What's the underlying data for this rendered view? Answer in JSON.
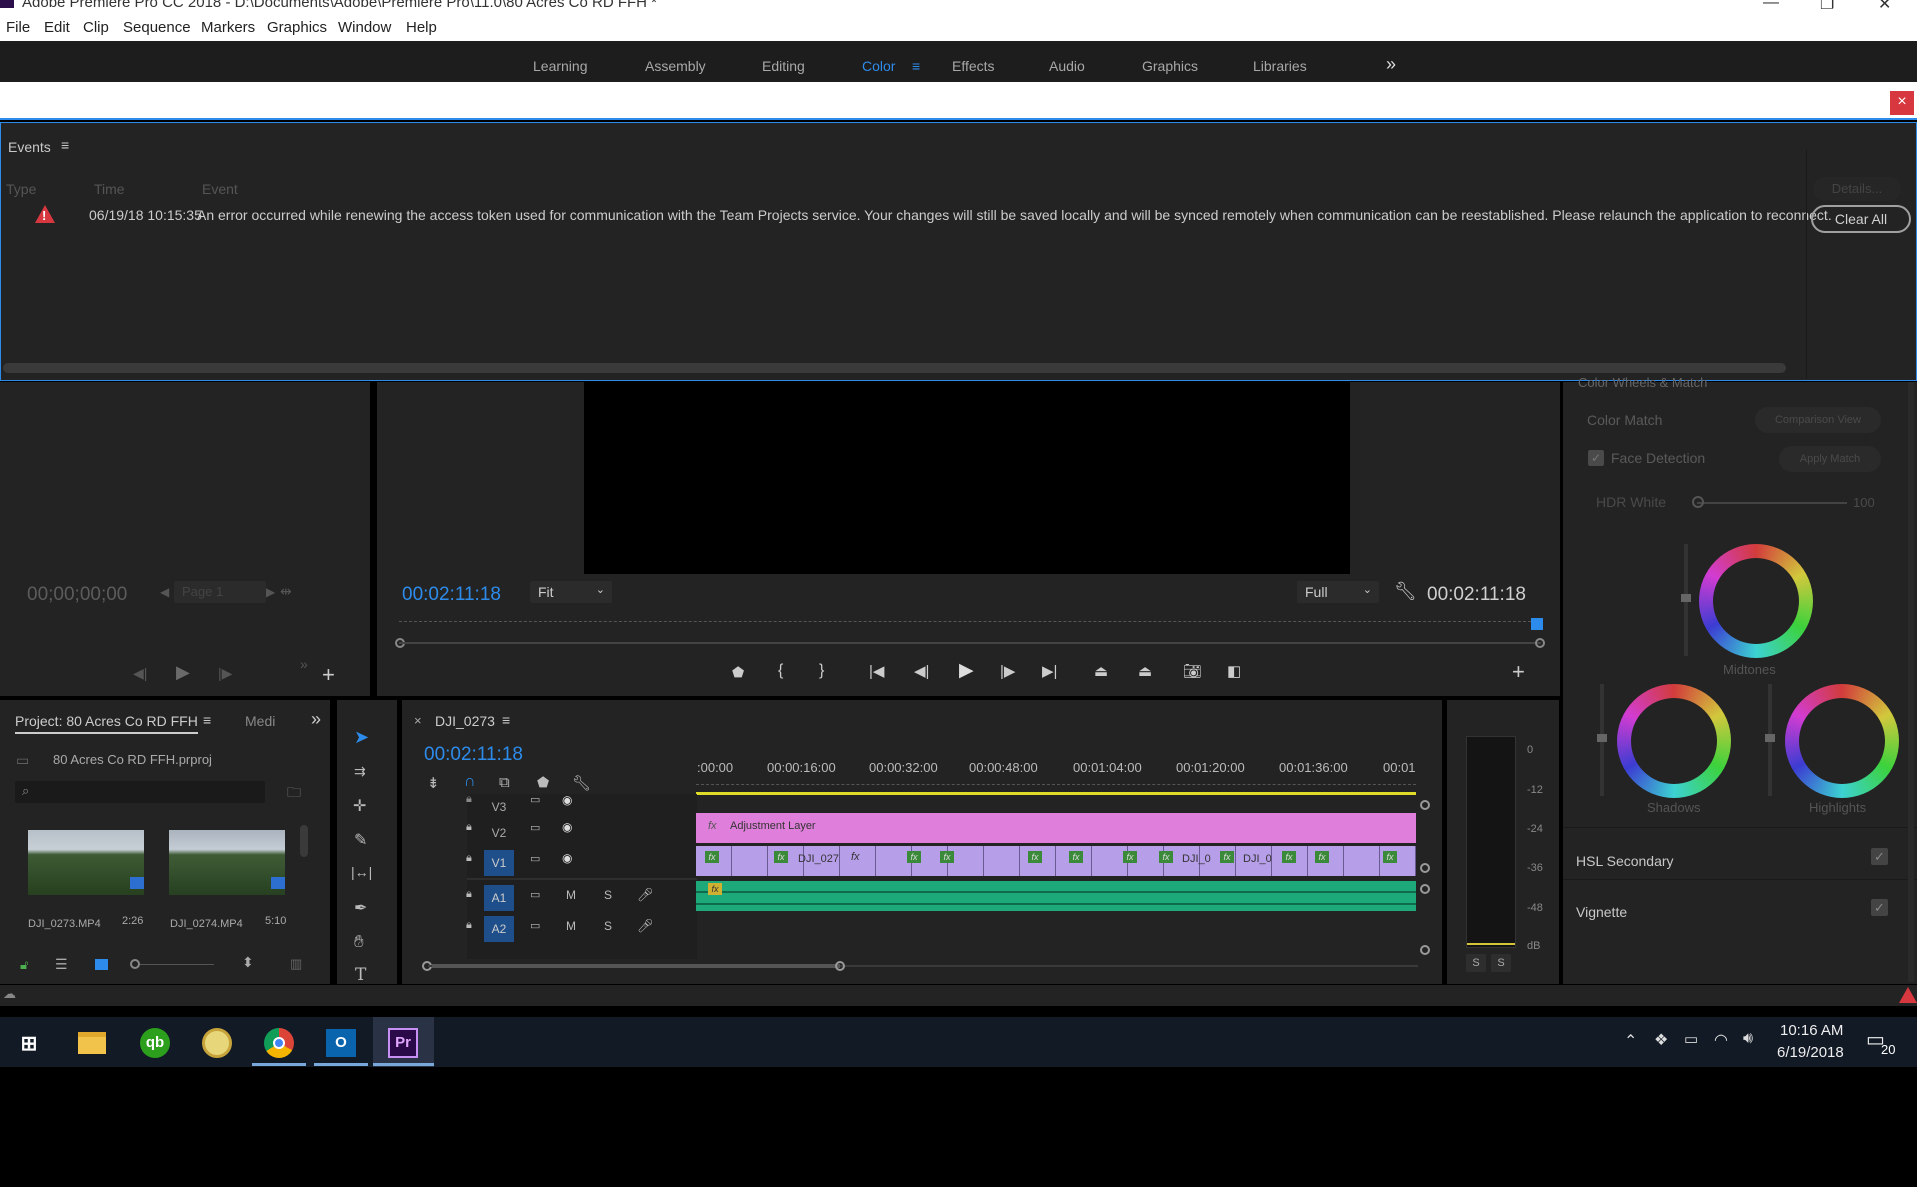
{
  "window": {
    "title": "Adobe Premiere Pro CC 2018 - D:\\Documents\\Adobe\\Premiere Pro\\11.0\\80 Acres Co RD FFH *"
  },
  "menu": [
    "File",
    "Edit",
    "Clip",
    "Sequence",
    "Markers",
    "Graphics",
    "Window",
    "Help"
  ],
  "workspaces": {
    "items": [
      "Learning",
      "Assembly",
      "Editing",
      "Color",
      "Effects",
      "Audio",
      "Graphics",
      "Libraries"
    ],
    "active": "Color",
    "more": "»"
  },
  "banner": {
    "close": "×"
  },
  "events": {
    "title": "Events",
    "menu_icon": "≡",
    "columns": [
      "Type",
      "Time",
      "Event"
    ],
    "rows": [
      {
        "type": "warning",
        "time": "06/19/18 10:15:35",
        "event": "An error occurred while renewing the access token used for communication with the Team Projects service. Your changes will still be saved locally and will be synced remotely when communication can be reestablished. Please relaunch the application to reconnect."
      }
    ],
    "details_label": "Details...",
    "clear_all_label": "Clear All"
  },
  "source_monitor": {
    "timecode": "00;00;00;00",
    "page_label": "Page 1"
  },
  "program_monitor": {
    "timecode_left": "00:02:11:18",
    "timecode_right": "00:02:11:18",
    "zoom": "Fit",
    "resolution": "Full"
  },
  "project": {
    "title": "Project: 80 Acres Co RD FFH",
    "menu_icon": "≡",
    "tab2": "Medi",
    "more": "»",
    "filename": "80 Acres Co RD FFH.prproj",
    "items": [
      {
        "name": "DJI_0273.MP4",
        "duration": "2:26"
      },
      {
        "name": "DJI_0274.MP4",
        "duration": "5:10"
      }
    ]
  },
  "timeline": {
    "sequence_name": "DJI_0273",
    "menu_icon": "≡",
    "timecode": "00:02:11:18",
    "ruler": [
      ":00:00",
      "00:00:16:00",
      "00:00:32:00",
      "00:00:48:00",
      "00:01:04:00",
      "00:01:20:00",
      "00:01:36:00",
      "00:01"
    ],
    "tracks": {
      "video": [
        "V3",
        "V2",
        "V1"
      ],
      "audio": [
        "A1",
        "A2"
      ],
      "mute": "M",
      "solo": "S"
    },
    "clips": {
      "adjustment_layer": "Adjustment Layer",
      "v1_labels": [
        "DJI_027",
        "DJI_0",
        "DJI_0"
      ],
      "fx": "fx"
    }
  },
  "audio_meter": {
    "scale": [
      "0",
      "-12",
      "-24",
      "-36",
      "-48",
      "dB"
    ],
    "solo_buttons": [
      "S",
      "S"
    ]
  },
  "lumetri": {
    "section_title": "Color Wheels & Match",
    "color_match": "Color Match",
    "comparison_view": "Comparison View",
    "face_detection": "Face Detection",
    "apply_match": "Apply Match",
    "hdr_white": "HDR White",
    "hdr_white_value": "100",
    "wheels": [
      "Midtones",
      "Shadows",
      "Highlights"
    ],
    "hsl_secondary": "HSL Secondary",
    "vignette": "Vignette"
  },
  "taskbar": {
    "time": "10:16 AM",
    "date": "6/19/2018",
    "notification_count": "20",
    "apps": [
      "windows-start",
      "file-explorer",
      "quickbooks",
      "app-face",
      "chrome",
      "outlook",
      "premiere-pro"
    ]
  }
}
